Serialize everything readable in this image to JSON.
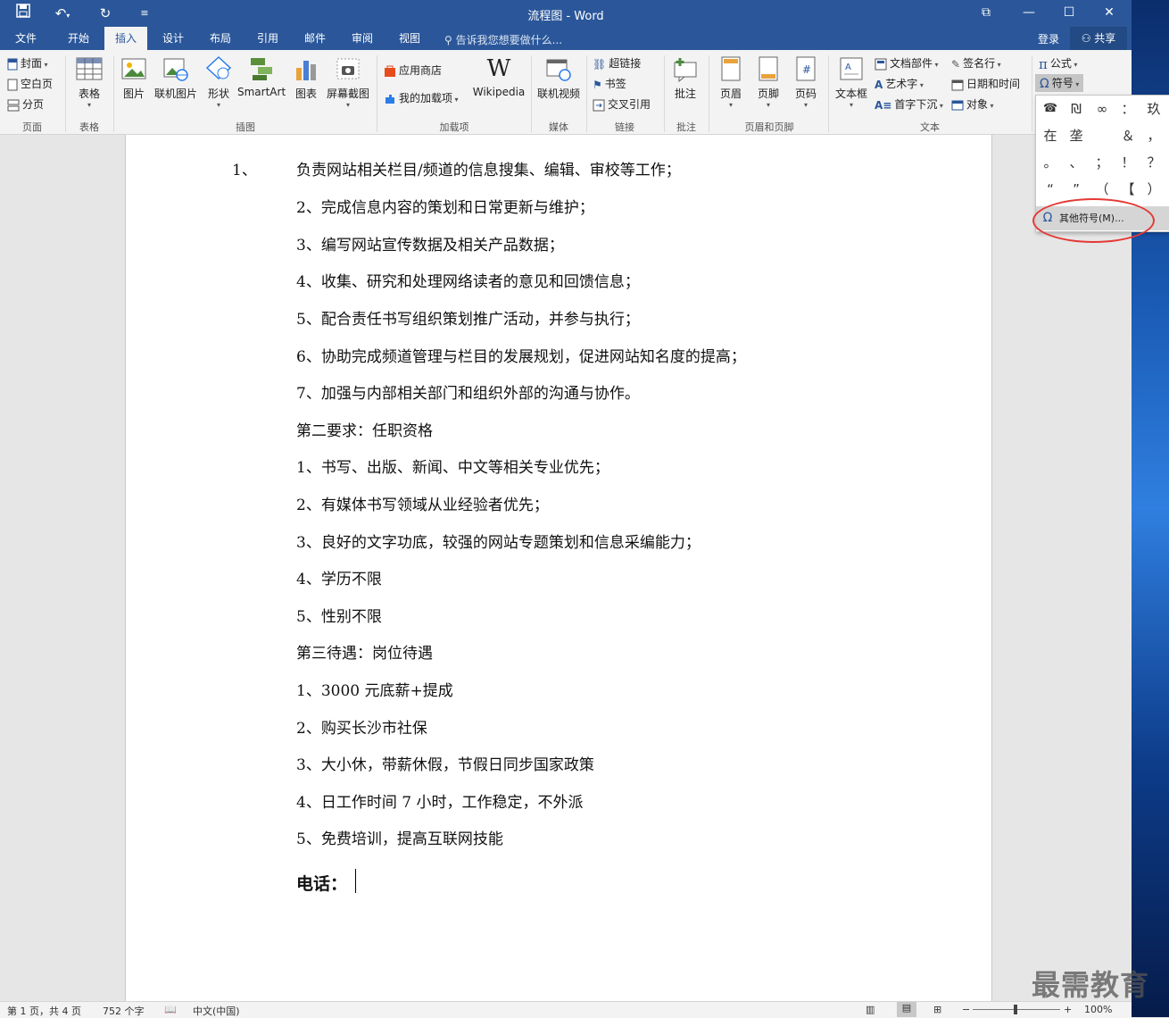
{
  "window": {
    "title": "流程图 - Word"
  },
  "tabs": [
    "文件",
    "开始",
    "插入",
    "设计",
    "布局",
    "引用",
    "邮件",
    "审阅",
    "视图"
  ],
  "active_tab": "插入",
  "tell_me": "告诉我您想要做什么...",
  "account": {
    "login": "登录",
    "share": "共享"
  },
  "ribbon": {
    "pages": {
      "cover": "封面",
      "blank": "空白页",
      "break": "分页",
      "label": "页面"
    },
    "tables": {
      "table": "表格",
      "label": "表格"
    },
    "illustrations": {
      "picture": "图片",
      "online_picture": "联机图片",
      "shapes": "形状",
      "smartart": "SmartArt",
      "chart": "图表",
      "screenshot": "屏幕截图",
      "label": "插图"
    },
    "addins": {
      "store": "应用商店",
      "my_addins": "我的加载项",
      "wikipedia": "Wikipedia",
      "label": "加载项"
    },
    "media": {
      "online_video": "联机视频",
      "label": "媒体"
    },
    "links": {
      "hyperlink": "超链接",
      "bookmark": "书签",
      "cross_ref": "交叉引用",
      "label": "链接"
    },
    "comments": {
      "comment": "批注",
      "label": "批注"
    },
    "header_footer": {
      "header": "页眉",
      "footer": "页脚",
      "page_number": "页码",
      "label": "页眉和页脚"
    },
    "text": {
      "textbox": "文本框",
      "quick_parts": "文档部件",
      "wordart": "艺术字",
      "dropcap": "首字下沉",
      "signature": "签名行",
      "datetime": "日期和时间",
      "object": "对象",
      "label": "文本"
    },
    "symbols": {
      "equation": "公式",
      "symbol": "符号"
    }
  },
  "symbol_dropdown": {
    "symbols": [
      "☎",
      "₪",
      "∞",
      "：",
      "玖",
      "在",
      "垄",
      "",
      "＆",
      "，",
      "。",
      "、",
      "；",
      "！",
      "？",
      "“",
      "”",
      "（",
      "【",
      "）"
    ],
    "more_symbols": "其他符号(M)..."
  },
  "document": {
    "lines": [
      "负责网站相关栏目/频道的信息搜集、编辑、审校等工作；",
      "2、完成信息内容的策划和日常更新与维护；",
      "3、编写网站宣传数据及相关产品数据；",
      "4、收集、研究和处理网络读者的意见和回馈信息；",
      "5、配合责任书写组织策划推广活动，并参与执行；",
      "6、协助完成频道管理与栏目的发展规划，促进网站知名度的提高；",
      "7、加强与内部相关部门和组织外部的沟通与协作。",
      "第二要求：任职资格",
      "1、书写、出版、新闻、中文等相关专业优先；",
      "2、有媒体书写领域从业经验者优先；",
      "3、良好的文字功底，较强的网站专题策划和信息采编能力；",
      "4、学历不限",
      "5、性别不限",
      "第三待遇：岗位待遇",
      "1、3000 元底薪+提成",
      "2、购买长沙市社保",
      "3、大小休，带薪休假，节假日同步国家政策",
      "4、日工作时间 7 小时，工作稳定，不外派",
      "5、免费培训，提高互联网技能"
    ],
    "first_number": "1、",
    "phone_label": "电话："
  },
  "status": {
    "page": "第 1 页，共 4 页",
    "words": "752 个字",
    "language": "中文(中国)",
    "zoom": "100%"
  },
  "watermark": "最需教育",
  "colors": {
    "word_blue": "#2b579a",
    "highlight_red": "#e53935"
  }
}
